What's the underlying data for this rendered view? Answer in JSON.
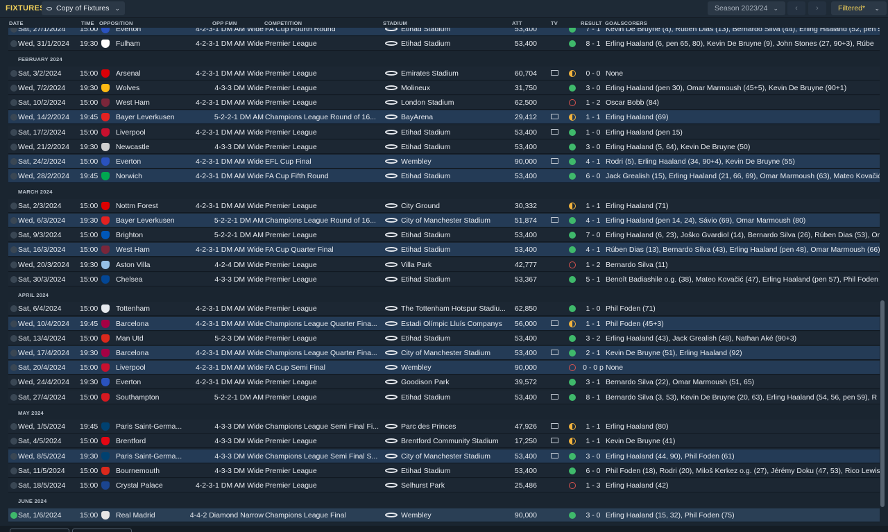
{
  "header": {
    "title": "FIXTURES",
    "view_label": "Copy of Fixtures",
    "season": "Season 2023/24",
    "prev_icon": "chevron-left-icon",
    "next_icon": "chevron-right-icon",
    "filter_label": "Filtered*"
  },
  "columns": {
    "date": "DATE",
    "time": "TIME",
    "opposition": "OPPOSITION",
    "opp_fmn": "OPP FMN",
    "competition": "COMPETITION",
    "stadium": "STADIUM",
    "att": "ATT",
    "tv": "TV",
    "result": "RESULT",
    "goalscorers": "GOALSCORERS"
  },
  "colors": {
    "accent": "#f2d15a",
    "win": "#3fb96b",
    "draw": "#f2b33d",
    "loss": "#d9534f"
  },
  "months": [
    "FEBRUARY 2024",
    "MARCH 2024",
    "APRIL 2024",
    "MAY 2024",
    "JUNE 2024"
  ],
  "fixtures": [
    {
      "date": "Sat, 27/1/2024",
      "time": "15:00",
      "opp": "Everton",
      "crest": "#2a52be",
      "fmn": "4-2-3-1 DM AM Wide",
      "comp": "FA Cup Fourth Round",
      "stadium": "Etihad Stadium",
      "att": "53,400",
      "tv": false,
      "outcome": "w",
      "score": "7 - 1",
      "scorers": "Kevin De Bruyne (4), Rúben Dias (13), Bernardo Silva (44), Erling Haaland (52, pen 5",
      "alt": true
    },
    {
      "date": "Wed, 31/1/2024",
      "time": "19:30",
      "opp": "Fulham",
      "crest": "#ffffff",
      "fmn": "4-2-3-1 DM AM Wide",
      "comp": "Premier League",
      "stadium": "Etihad Stadium",
      "att": "53,400",
      "tv": false,
      "outcome": "w",
      "score": "8 - 1",
      "scorers": "Erling Haaland (6, pen 65, 80), Kevin De Bruyne (9), John Stones (27, 90+3), Rúbe",
      "alt": false
    },
    {
      "date": "Sat, 3/2/2024",
      "time": "15:00",
      "opp": "Arsenal",
      "crest": "#db0007",
      "fmn": "4-2-3-1 DM AM Wide",
      "comp": "Premier League",
      "stadium": "Emirates Stadium",
      "att": "60,704",
      "tv": true,
      "outcome": "d",
      "score": "0 - 0",
      "scorers": "None",
      "alt": false
    },
    {
      "date": "Wed, 7/2/2024",
      "time": "19:30",
      "opp": "Wolves",
      "crest": "#fdb913",
      "fmn": "4-3-3 DM Wide",
      "comp": "Premier League",
      "stadium": "Molineux",
      "att": "31,750",
      "tv": false,
      "outcome": "w",
      "score": "3 - 0",
      "scorers": "Erling Haaland (pen 30), Omar Marmoush (45+5), Kevin De Bruyne (90+1)",
      "alt": false
    },
    {
      "date": "Sat, 10/2/2024",
      "time": "15:00",
      "opp": "West Ham",
      "crest": "#7a263a",
      "fmn": "4-2-3-1 DM AM Wide",
      "comp": "Premier League",
      "stadium": "London Stadium",
      "att": "62,500",
      "tv": false,
      "outcome": "l",
      "score": "1 - 2",
      "scorers": "Oscar Bobb (84)",
      "alt": false
    },
    {
      "date": "Wed, 14/2/2024",
      "time": "19:45",
      "opp": "Bayer Leverkusen",
      "crest": "#e32221",
      "fmn": "5-2-2-1 DM AM",
      "comp": "Champions League Round of 16...",
      "stadium": "BayArena",
      "att": "29,412",
      "tv": true,
      "outcome": "d",
      "score": "1 - 1",
      "scorers": "Erling Haaland (69)",
      "alt": true
    },
    {
      "date": "Sat, 17/2/2024",
      "time": "15:00",
      "opp": "Liverpool",
      "crest": "#c8102e",
      "fmn": "4-2-3-1 DM AM Wide",
      "comp": "Premier League",
      "stadium": "Etihad Stadium",
      "att": "53,400",
      "tv": true,
      "outcome": "w",
      "score": "1 - 0",
      "scorers": "Erling Haaland (pen 15)",
      "alt": false
    },
    {
      "date": "Wed, 21/2/2024",
      "time": "19:30",
      "opp": "Newcastle",
      "crest": "#cfcfcf",
      "fmn": "4-3-3 DM Wide",
      "comp": "Premier League",
      "stadium": "Etihad Stadium",
      "att": "53,400",
      "tv": false,
      "outcome": "w",
      "score": "3 - 0",
      "scorers": "Erling Haaland (5, 64), Kevin De Bruyne (50)",
      "alt": false
    },
    {
      "date": "Sat, 24/2/2024",
      "time": "15:00",
      "opp": "Everton",
      "crest": "#2a52be",
      "fmn": "4-2-3-1 DM AM Wide",
      "comp": "EFL Cup Final",
      "stadium": "Wembley",
      "att": "90,000",
      "tv": true,
      "outcome": "w",
      "score": "4 - 1",
      "scorers": "Rodri (5), Erling Haaland (34, 90+4), Kevin De Bruyne (55)",
      "alt": true
    },
    {
      "date": "Wed, 28/2/2024",
      "time": "19:45",
      "opp": "Norwich",
      "crest": "#00a650",
      "fmn": "4-2-3-1 DM AM Wide",
      "comp": "FA Cup Fifth Round",
      "stadium": "Etihad Stadium",
      "att": "53,400",
      "tv": false,
      "outcome": "w",
      "score": "6 - 0",
      "scorers": "Jack Grealish (15), Erling Haaland (21, 66, 69), Omar Marmoush (63), Mateo Kovačić",
      "alt": true
    },
    {
      "date": "Sat, 2/3/2024",
      "time": "15:00",
      "opp": "Nottm Forest",
      "crest": "#dd0000",
      "fmn": "4-2-3-1 DM AM Wide",
      "comp": "Premier League",
      "stadium": "City Ground",
      "att": "30,332",
      "tv": false,
      "outcome": "d",
      "score": "1 - 1",
      "scorers": "Erling Haaland (71)",
      "alt": false
    },
    {
      "date": "Wed, 6/3/2024",
      "time": "19:30",
      "opp": "Bayer Leverkusen",
      "crest": "#e32221",
      "fmn": "5-2-2-1 DM AM",
      "comp": "Champions League Round of 16...",
      "stadium": "City of Manchester Stadium",
      "att": "51,874",
      "tv": true,
      "outcome": "w",
      "score": "4 - 1",
      "scorers": "Erling Haaland (pen 14, 24), Sávio (69), Omar Marmoush (80)",
      "alt": true
    },
    {
      "date": "Sat, 9/3/2024",
      "time": "15:00",
      "opp": "Brighton",
      "crest": "#0057b8",
      "fmn": "5-2-2-1 DM AM",
      "comp": "Premier League",
      "stadium": "Etihad Stadium",
      "att": "53,400",
      "tv": false,
      "outcome": "w",
      "score": "7 - 0",
      "scorers": "Erling Haaland (6, 23), Joško Gvardiol (14), Bernardo Silva (26), Rúben Dias (53), Or",
      "alt": false
    },
    {
      "date": "Sat, 16/3/2024",
      "time": "15:00",
      "opp": "West Ham",
      "crest": "#7a263a",
      "fmn": "4-2-3-1 DM AM Wide",
      "comp": "FA Cup Quarter Final",
      "stadium": "Etihad Stadium",
      "att": "53,400",
      "tv": false,
      "outcome": "w",
      "score": "4 - 1",
      "scorers": "Rúben Dias (13), Bernardo Silva (43), Erling Haaland (pen 48), Omar Marmoush (66)",
      "alt": true
    },
    {
      "date": "Wed, 20/3/2024",
      "time": "19:30",
      "opp": "Aston Villa",
      "crest": "#95bfe5",
      "fmn": "4-2-4 DM Wide",
      "comp": "Premier League",
      "stadium": "Villa Park",
      "att": "42,777",
      "tv": false,
      "outcome": "l",
      "score": "1 - 2",
      "scorers": "Bernardo Silva (11)",
      "alt": false
    },
    {
      "date": "Sat, 30/3/2024",
      "time": "15:00",
      "opp": "Chelsea",
      "crest": "#034694",
      "fmn": "4-3-3 DM Wide",
      "comp": "Premier League",
      "stadium": "Etihad Stadium",
      "att": "53,367",
      "tv": false,
      "outcome": "w",
      "score": "5 - 1",
      "scorers": "Benoît Badiashile o.g. (38), Mateo Kovačić (47), Erling Haaland (pen 57), Phil Foden",
      "alt": false
    },
    {
      "date": "Sat, 6/4/2024",
      "time": "15:00",
      "opp": "Tottenham",
      "crest": "#e6e9ee",
      "fmn": "4-2-3-1 DM AM Wide",
      "comp": "Premier League",
      "stadium": "The Tottenham Hotspur Stadiu...",
      "att": "62,850",
      "tv": false,
      "outcome": "w",
      "score": "1 - 0",
      "scorers": "Phil Foden (71)",
      "alt": false
    },
    {
      "date": "Wed, 10/4/2024",
      "time": "19:45",
      "opp": "Barcelona",
      "crest": "#a50044",
      "fmn": "4-2-3-1 DM AM Wide",
      "comp": "Champions League Quarter Fina...",
      "stadium": "Estadi Olímpic Lluís Companys",
      "att": "56,000",
      "tv": true,
      "outcome": "d",
      "score": "1 - 1",
      "scorers": "Phil Foden (45+3)",
      "alt": true
    },
    {
      "date": "Sat, 13/4/2024",
      "time": "15:00",
      "opp": "Man Utd",
      "crest": "#da291c",
      "fmn": "5-2-3 DM Wide",
      "comp": "Premier League",
      "stadium": "Etihad Stadium",
      "att": "53,400",
      "tv": false,
      "outcome": "w",
      "score": "3 - 2",
      "scorers": "Erling Haaland (43), Jack Grealish (48), Nathan Aké (90+3)",
      "alt": false
    },
    {
      "date": "Wed, 17/4/2024",
      "time": "19:30",
      "opp": "Barcelona",
      "crest": "#a50044",
      "fmn": "4-2-3-1 DM AM Wide",
      "comp": "Champions League Quarter Fina...",
      "stadium": "City of Manchester Stadium",
      "att": "53,400",
      "tv": true,
      "outcome": "w",
      "score": "2 - 1",
      "scorers": "Kevin De Bruyne (51), Erling Haaland (92)",
      "alt": true
    },
    {
      "date": "Sat, 20/4/2024",
      "time": "15:00",
      "opp": "Liverpool",
      "crest": "#c8102e",
      "fmn": "4-2-3-1 DM AM Wide",
      "comp": "FA Cup Semi Final",
      "stadium": "Wembley",
      "att": "90,000",
      "tv": false,
      "outcome": "l",
      "score": "0 - 0 p",
      "scorers": "None",
      "alt": true
    },
    {
      "date": "Wed, 24/4/2024",
      "time": "19:30",
      "opp": "Everton",
      "crest": "#2a52be",
      "fmn": "4-2-3-1 DM AM Wide",
      "comp": "Premier League",
      "stadium": "Goodison Park",
      "att": "39,572",
      "tv": false,
      "outcome": "w",
      "score": "3 - 1",
      "scorers": "Bernardo Silva (22), Omar Marmoush (51, 65)",
      "alt": false
    },
    {
      "date": "Sat, 27/4/2024",
      "time": "15:00",
      "opp": "Southampton",
      "crest": "#d71920",
      "fmn": "5-2-2-1 DM AM",
      "comp": "Premier League",
      "stadium": "Etihad Stadium",
      "att": "53,400",
      "tv": true,
      "outcome": "w",
      "score": "8 - 1",
      "scorers": "Bernardo Silva (3, 53), Kevin De Bruyne (20, 63), Erling Haaland (54, 56, pen 59), R",
      "alt": false
    },
    {
      "date": "Wed, 1/5/2024",
      "time": "19:45",
      "opp": "Paris Saint-Germa...",
      "crest": "#004170",
      "fmn": "4-3-3 DM Wide",
      "comp": "Champions League Semi Final Fi...",
      "stadium": "Parc des Princes",
      "att": "47,926",
      "tv": true,
      "outcome": "d",
      "score": "1 - 1",
      "scorers": "Erling Haaland (80)",
      "alt": false
    },
    {
      "date": "Sat, 4/5/2024",
      "time": "15:00",
      "opp": "Brentford",
      "crest": "#e30613",
      "fmn": "4-3-3 DM Wide",
      "comp": "Premier League",
      "stadium": "Brentford Community Stadium",
      "att": "17,250",
      "tv": true,
      "outcome": "d",
      "score": "1 - 1",
      "scorers": "Kevin De Bruyne (41)",
      "alt": false
    },
    {
      "date": "Wed, 8/5/2024",
      "time": "19:30",
      "opp": "Paris Saint-Germa...",
      "crest": "#004170",
      "fmn": "4-3-3 DM Wide",
      "comp": "Champions League Semi Final S...",
      "stadium": "City of Manchester Stadium",
      "att": "53,400",
      "tv": true,
      "outcome": "w",
      "score": "3 - 0",
      "scorers": "Erling Haaland (44, 90), Phil Foden (61)",
      "alt": true
    },
    {
      "date": "Sat, 11/5/2024",
      "time": "15:00",
      "opp": "Bournemouth",
      "crest": "#da291c",
      "fmn": "4-3-3 DM Wide",
      "comp": "Premier League",
      "stadium": "Etihad Stadium",
      "att": "53,400",
      "tv": false,
      "outcome": "w",
      "score": "6 - 0",
      "scorers": "Phil Foden (18), Rodri (20), Miloš Kerkez o.g. (27), Jérémy Doku (47, 53), Rico Lewis",
      "alt": false
    },
    {
      "date": "Sat, 18/5/2024",
      "time": "15:00",
      "opp": "Crystal Palace",
      "crest": "#1b458f",
      "fmn": "4-2-3-1 DM AM Wide",
      "comp": "Premier League",
      "stadium": "Selhurst Park",
      "att": "25,486",
      "tv": false,
      "outcome": "l",
      "score": "1 - 3",
      "scorers": "Erling Haaland (42)",
      "alt": false
    },
    {
      "date": "Sat, 1/6/2024",
      "time": "15:00",
      "opp": "Real Madrid",
      "crest": "#e6e6e6",
      "fmn": "4-4-2 Diamond Narrow",
      "comp": "Champions League Final",
      "stadium": "Wembley",
      "att": "90,000",
      "tv": false,
      "outcome": "w",
      "score": "3 - 0",
      "scorers": "Erling Haaland (15, 32), Phil Foden (75)",
      "alt": false,
      "selected": true
    }
  ]
}
